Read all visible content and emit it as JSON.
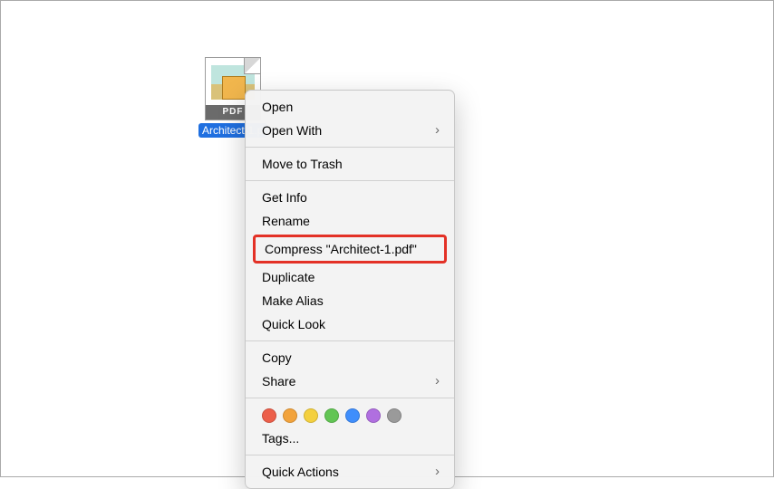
{
  "file": {
    "label": "Architect-1.pdf",
    "badge": "PDF"
  },
  "menu": {
    "open": "Open",
    "open_with": "Open With",
    "move_to_trash": "Move to Trash",
    "get_info": "Get Info",
    "rename": "Rename",
    "compress": "Compress \"Architect-1.pdf\"",
    "duplicate": "Duplicate",
    "make_alias": "Make Alias",
    "quick_look": "Quick Look",
    "copy": "Copy",
    "share": "Share",
    "tags": "Tags...",
    "quick_actions": "Quick Actions"
  },
  "tag_colors": {
    "red": "#ec5f4a",
    "orange": "#f2a33c",
    "yellow": "#f4d03f",
    "green": "#62c554",
    "blue": "#3f8efc",
    "purple": "#b06fe0",
    "gray": "#9a9a9a"
  }
}
